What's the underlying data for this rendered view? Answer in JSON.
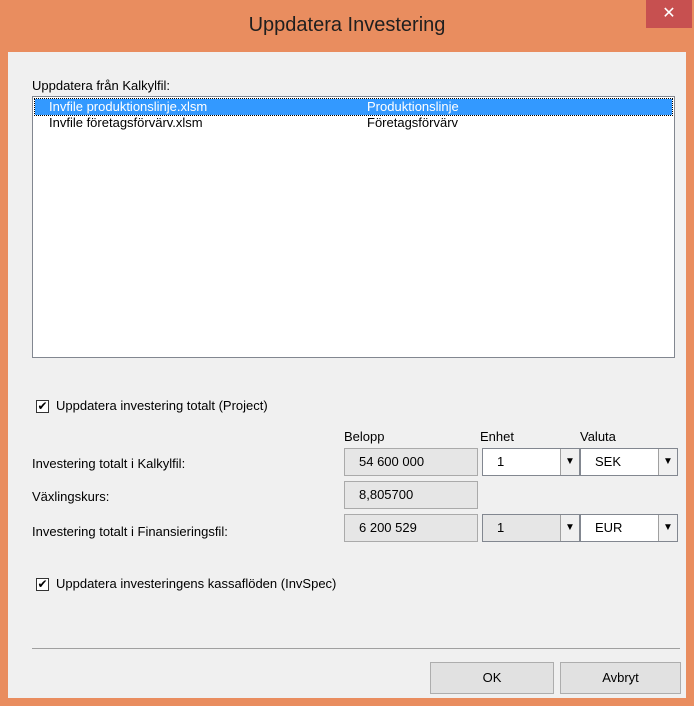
{
  "window": {
    "title": "Uppdatera Investering",
    "close_glyph": "✕"
  },
  "list": {
    "label": "Uppdatera från Kalkylfil:",
    "rows": [
      {
        "file": "Invfile produktionslinje.xlsm",
        "name": "Produktionslinje",
        "selected": true
      },
      {
        "file": "Invfile företagsförvärv.xlsm",
        "name": "Företagsförvärv",
        "selected": false
      }
    ]
  },
  "checkbox_project": {
    "label": "Uppdatera investering totalt (Project)",
    "checked": true,
    "mark": "✔"
  },
  "columns": {
    "belopp": "Belopp",
    "enhet": "Enhet",
    "valuta": "Valuta"
  },
  "rows": {
    "kalkyl": {
      "label": "Investering totalt i Kalkylfil:",
      "belopp": "54 600 000",
      "enhet": "1",
      "valuta": "SEK"
    },
    "vaxling": {
      "label": "Växlingskurs:",
      "value": "8,805700"
    },
    "finans": {
      "label": "Investering totalt i Finansieringsfil:",
      "belopp": "6 200 529",
      "enhet": "1",
      "valuta": "EUR"
    }
  },
  "checkbox_invspec": {
    "label": "Uppdatera investeringens kassaflöden (InvSpec)",
    "checked": true,
    "mark": "✔"
  },
  "buttons": {
    "ok": "OK",
    "cancel": "Avbryt"
  },
  "icons": {
    "dropdown": "▼"
  }
}
